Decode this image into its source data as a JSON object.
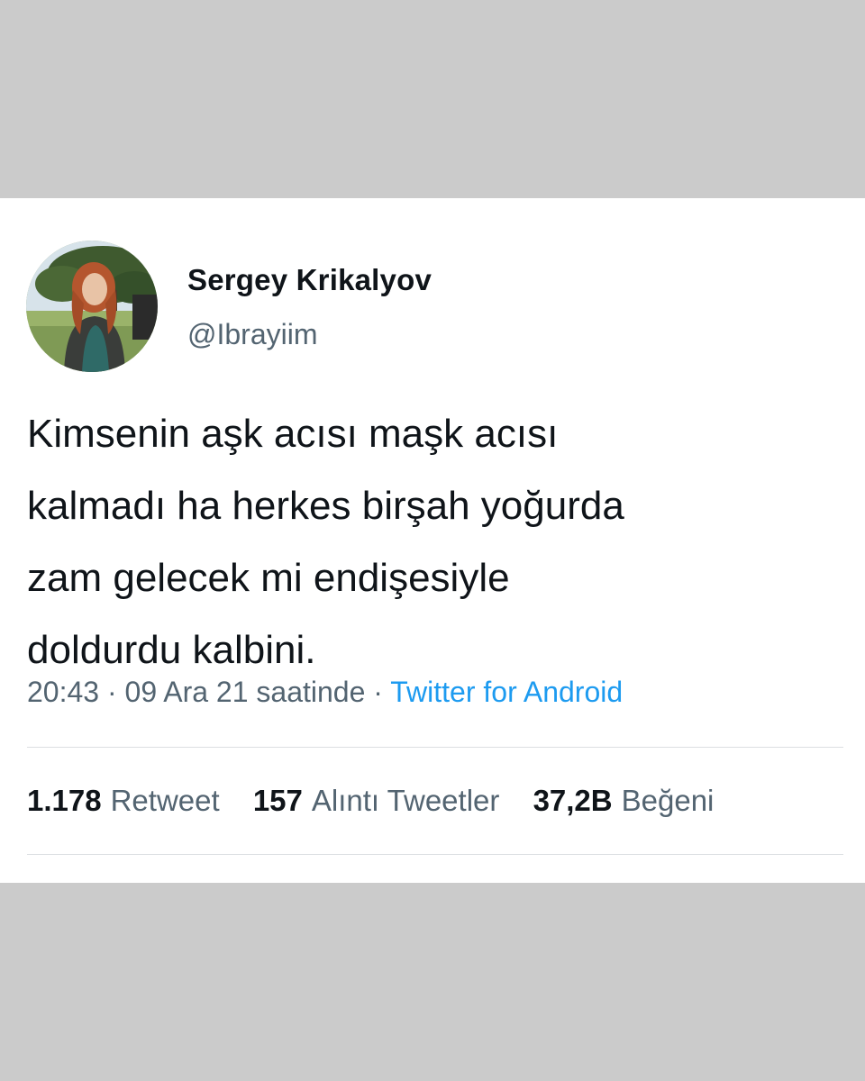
{
  "tweet": {
    "display_name": "Sergey Krikalyov",
    "handle": "@Ibrayiim",
    "avatar_icon": "profile-photo",
    "text_lines": [
      "Kimsenin aşk acısı maşk acısı",
      "kalmadı ha herkes birşah yoğurda",
      "zam gelecek mi endişesiyle",
      "doldurdu kalbini."
    ],
    "time": "20:43",
    "separator": "·",
    "date": "09 Ara 21 saatinde",
    "source": "Twitter for Android",
    "stats": {
      "retweets_count": "1.178",
      "retweets_label": "Retweet",
      "quotes_count": "157",
      "quotes_label": "Alıntı Tweetler",
      "likes_count": "37,2B",
      "likes_label": "Beğeni"
    }
  },
  "colors": {
    "background": "#cbcbcb",
    "card": "#ffffff",
    "text_primary": "#0f1419",
    "text_secondary": "#536471",
    "link": "#1d9bf0"
  }
}
